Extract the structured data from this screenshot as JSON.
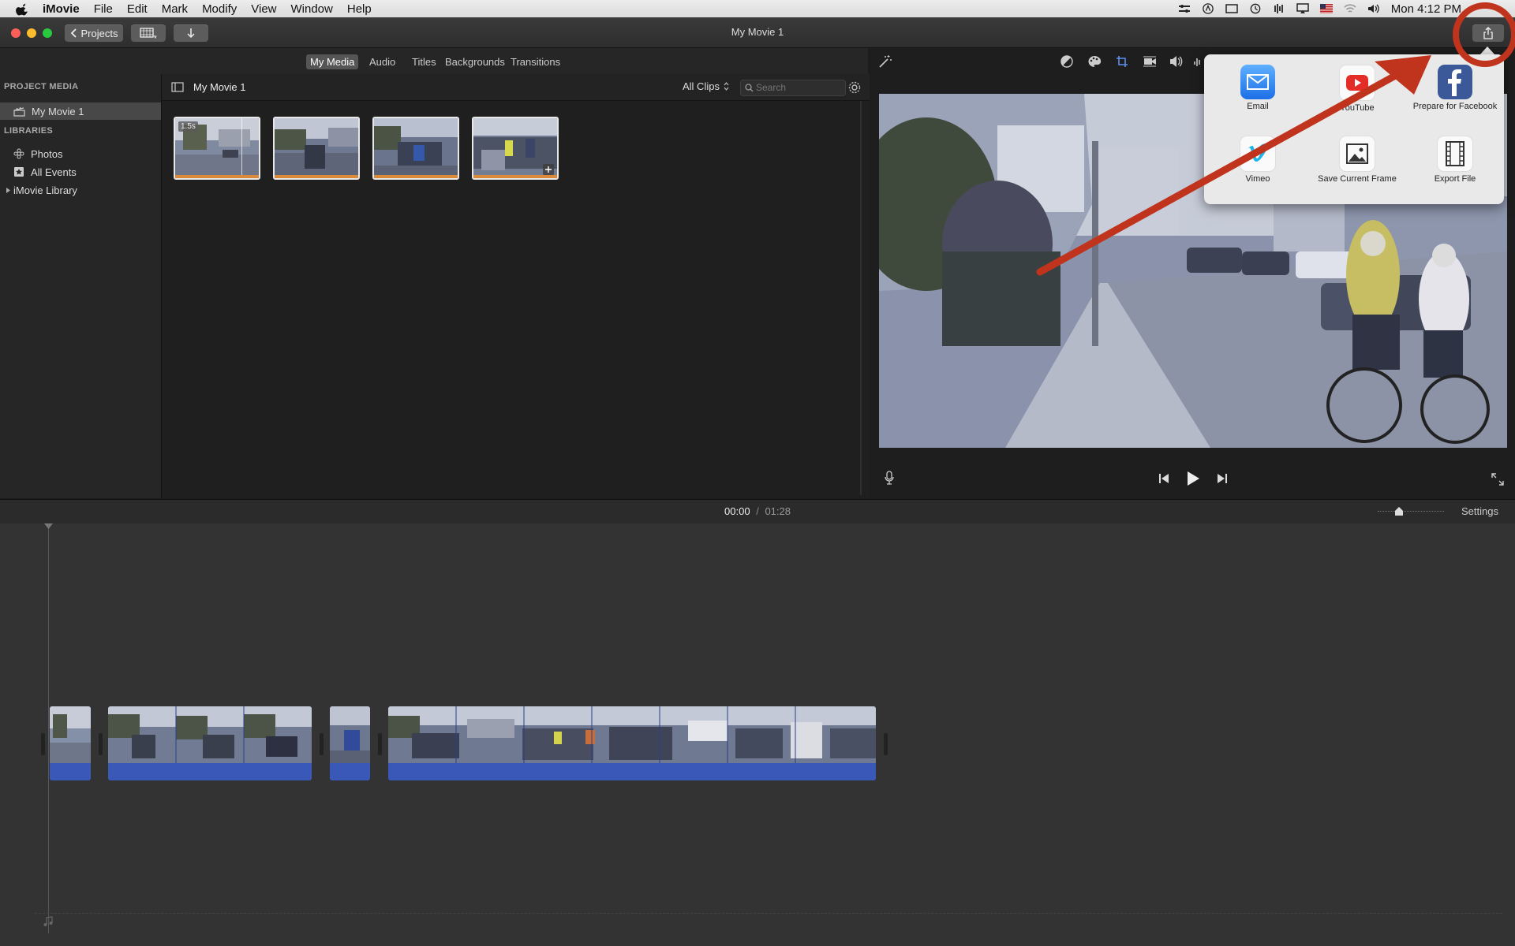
{
  "menubar": {
    "app": "iMovie",
    "items": [
      "File",
      "Edit",
      "Mark",
      "Modify",
      "View",
      "Window",
      "Help"
    ],
    "clock": "Mon 4:12 PM"
  },
  "toolbar": {
    "projects_label": "Projects",
    "window_title": "My Movie 1"
  },
  "media_tabs": [
    "My Media",
    "Audio",
    "Titles",
    "Backgrounds",
    "Transitions"
  ],
  "sidebar": {
    "project_media_header": "PROJECT MEDIA",
    "project_item": "My Movie 1",
    "libraries_header": "LIBRARIES",
    "library_items": [
      "Photos",
      "All Events",
      "iMovie Library"
    ]
  },
  "browser": {
    "title": "My Movie 1",
    "filter": "All Clips",
    "search_placeholder": "Search",
    "first_clip_duration": "1.5s"
  },
  "timeline": {
    "current_time": "00:00",
    "separator": "/",
    "total_time": "01:28",
    "settings_label": "Settings"
  },
  "share": {
    "items": [
      "Email",
      "YouTube",
      "Prepare for Facebook",
      "Vimeo",
      "Save Current Frame",
      "Export File"
    ]
  },
  "colors": {
    "annotation": "#c0341d",
    "clip_audio": "#3a58b8",
    "thumb_bar": "#d98a3a"
  }
}
